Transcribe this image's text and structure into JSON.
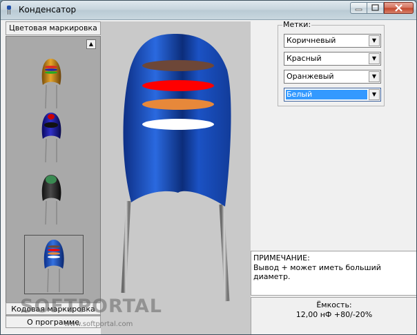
{
  "window": {
    "title": "Конденсатор"
  },
  "left_panel": {
    "header": "Цветовая маркировка",
    "code_button": "Кодовая маркировка",
    "about_button": "О программе"
  },
  "marks": {
    "legend": "Метки:",
    "combos": [
      {
        "value": "Коричневый",
        "color": "#6d4738"
      },
      {
        "value": "Красный",
        "color": "#ff0000"
      },
      {
        "value": "Оранжевый",
        "color": "#e7883a"
      },
      {
        "value": "Белый",
        "color": "#ffffff"
      }
    ]
  },
  "note": {
    "title": "ПРИМЕЧАНИЕ:",
    "text": "Вывод + может иметь больший диаметр."
  },
  "capacity": {
    "label": "Ёмкость:",
    "value": "12,00 нФ +80/-20%"
  },
  "watermark": {
    "main": "SOFTPORTAL",
    "url": "www.softportal.com"
  },
  "colors": {
    "capacitor_body": "#1f5fd0",
    "thumb_1": "#c0851a",
    "thumb_2": "#1a1aa0",
    "thumb_3": "#2a2a2a",
    "thumb_4": "#1a4fc8"
  }
}
